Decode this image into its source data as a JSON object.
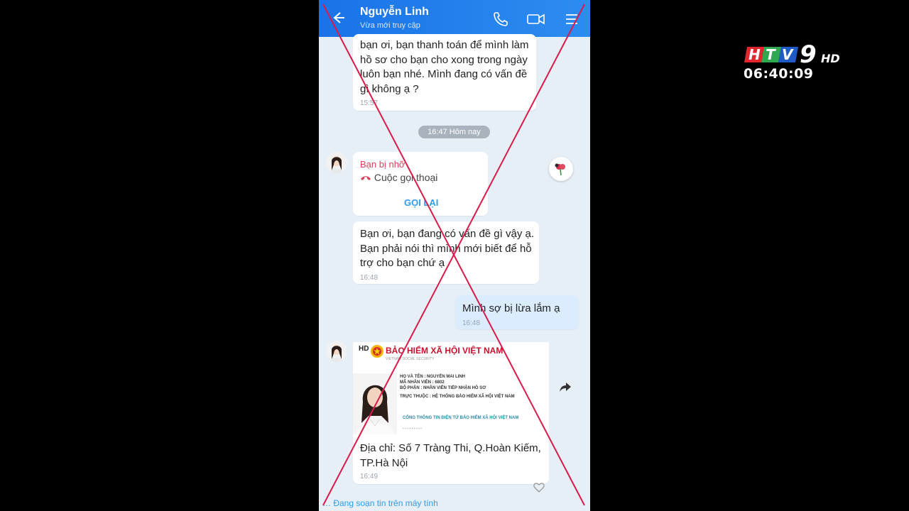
{
  "tv": {
    "channel_logo": "HTV9 HD",
    "clock": "06:40:09"
  },
  "header": {
    "back_icon": "back-arrow-icon",
    "contact_name": "Nguyễn Linh",
    "status": "Vừa mới truy cập"
  },
  "messages": {
    "m1_text": "bạn ơi, bạn thanh toán để mình làm hồ sơ cho bạn cho xong trong ngày luôn bạn nhé. Mình đang có vấn đề gì không ạ ?",
    "m1_time": "15:57",
    "day_separator": "16:47 Hôm nay",
    "call_title": "Bạn bị nhỡ",
    "call_desc": "Cuộc gọi thoại",
    "call_back": "GỌI LẠI",
    "m2_text": "Bạn ơi, bạn đang có vấn đề gì vậy ạ. Bạn phải nói thì mình mới biết để hỗ trợ cho bạn chứ ạ",
    "m2_time": "16:48",
    "m3_text": "Mình sợ bị lừa lắm ạ",
    "m3_time": "16:48",
    "card": {
      "hd": "HD",
      "org_title": "BẢO HIỂM XÃ HỘI VIỆT NAM",
      "org_sub": "VIETNAM SOCIAL SECURITY",
      "line1": "HỌ VÀ TÊN : NGUYỄN MAI LINH",
      "line2": "MÃ NHÂN VIÊN : 6802",
      "line3": "BỘ PHẬN : NHÂN VIÊN TIẾP NHẬN HỒ SƠ",
      "line4": "TRỰC THUỘC : HỆ THỐNG BẢO HIỂM XÃ HỘI VIỆT NAM",
      "portal": "CỔNG THÔNG TIN ĐIỆN TỬ BẢO HIỂM XÃ HỘI VIỆT NAM",
      "address": "Địa chỉ: Số 7 Tràng Thi, Q.Hoàn Kiếm, TP.Hà Nội",
      "time": "16:49"
    }
  },
  "composer": {
    "status": "Đang soạn tin trên máy tính"
  },
  "colors": {
    "header_blue": "#1a73e8",
    "red_x": "#d81b4a",
    "link_blue": "#2a9df4"
  }
}
